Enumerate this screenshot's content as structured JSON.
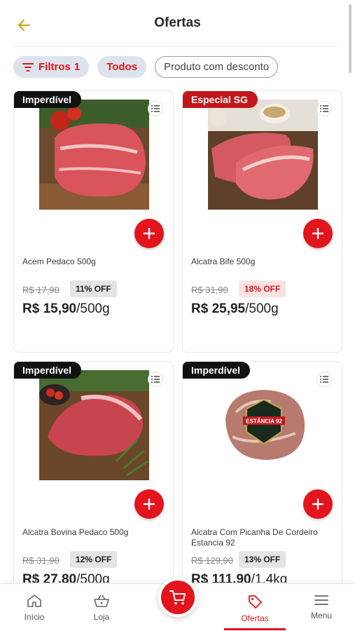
{
  "header": {
    "title": "Ofertas"
  },
  "chips": {
    "filter_label": "Filtros",
    "filter_count": "1",
    "todos": "Todos",
    "discount": "Produto com desconto"
  },
  "products": [
    {
      "tag": "Imperdível",
      "tag_color": "#111111",
      "name": "Acem Pedaco 500g",
      "old_price": "R$ 17,90",
      "discount": "11% OFF",
      "price": "R$ 15,90",
      "unit": "/500g",
      "image": "beef-chunk-photo"
    },
    {
      "tag": "Especial SG",
      "tag_color": "#c4161c",
      "name": "Alcatra Bife 500g",
      "old_price": "R$ 31,90",
      "discount": "18% OFF",
      "price": "R$ 25,95",
      "unit": "/500g",
      "image": "beef-steaks-photo"
    },
    {
      "tag": "Imperdível",
      "tag_color": "#111111",
      "name": "Alcatra Bovina Pedaco 500g",
      "old_price": "R$ 31,90",
      "discount": "12% OFF",
      "price": "R$ 27,80",
      "unit": "/500g",
      "image": "beef-roast-photo"
    },
    {
      "tag": "Imperdível",
      "tag_color": "#111111",
      "name": "Alcatra Com Picanha De Cordeiro Estancia 92",
      "old_price": "R$ 129,90",
      "discount": "13% OFF",
      "price": "R$ 111,90",
      "unit": "/1,4kg",
      "image": "lamb-packaged-photo",
      "logo_text": "ESTÂNCIA 92"
    }
  ],
  "nav": {
    "items": [
      "Início",
      "Loja",
      "Ofertas",
      "Menu"
    ],
    "active": "Ofertas"
  },
  "colors": {
    "accent": "#e3141b",
    "back_arrow": "#d9a01c"
  }
}
